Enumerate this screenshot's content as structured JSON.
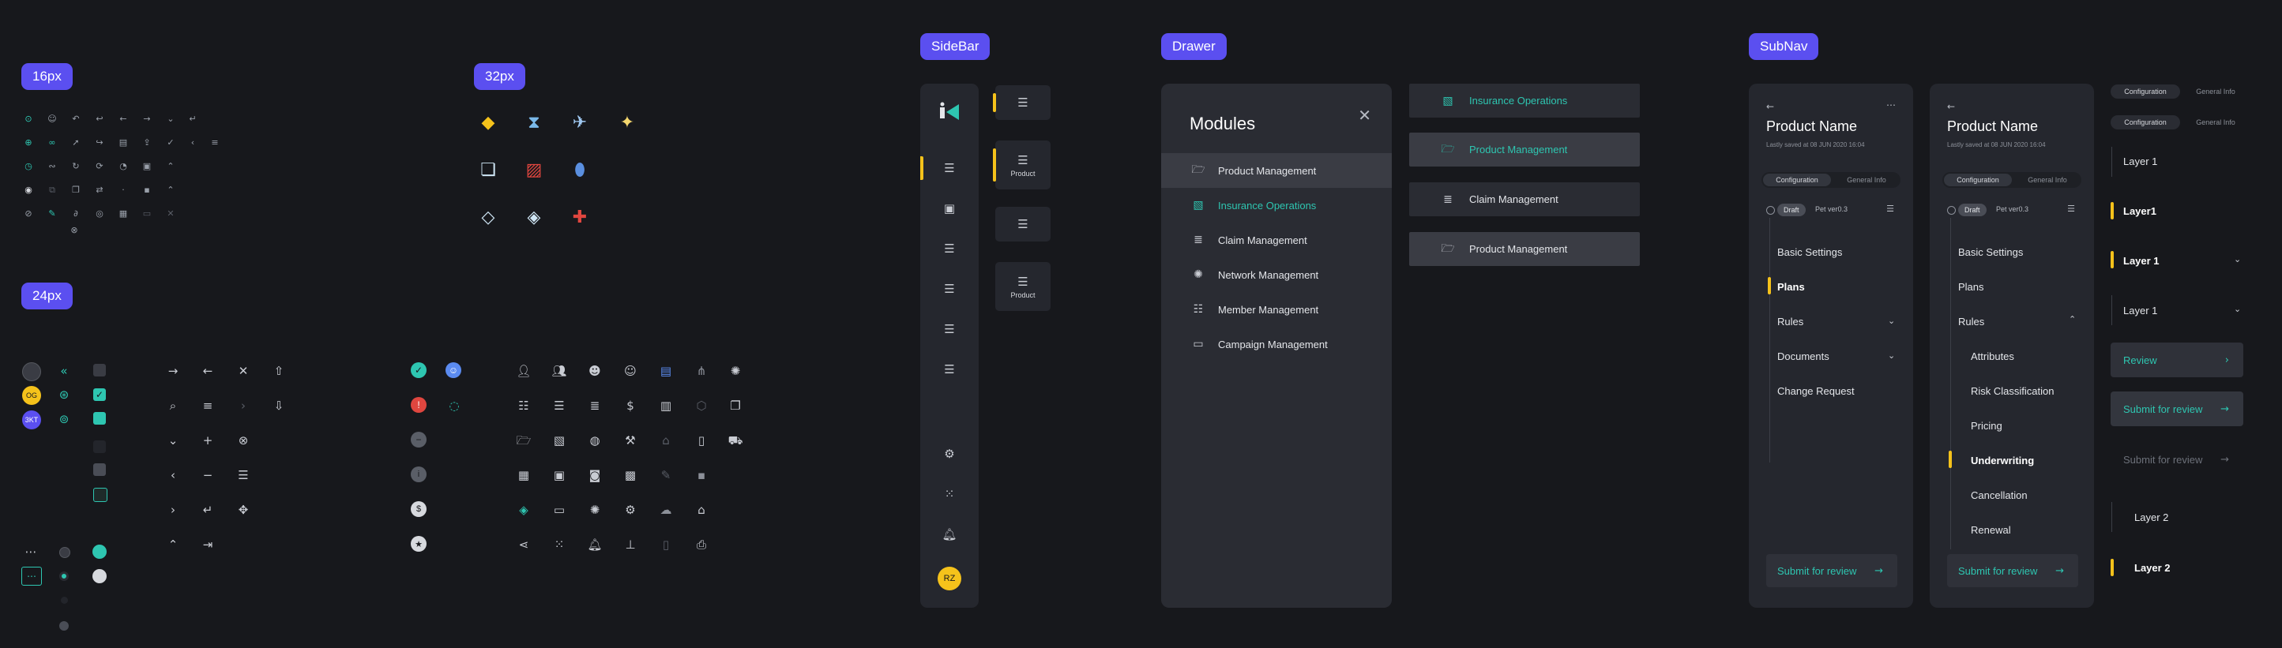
{
  "colors": {
    "background": "#17181c",
    "panel": "#25272e",
    "accent_purple": "#5b4ff0",
    "accent_teal": "#2ec6b1",
    "accent_yellow": "#f5c21b",
    "danger": "#e0463f"
  },
  "tags": {
    "s16": "16px",
    "s32": "32px",
    "s24": "24px",
    "sidebar": "SideBar",
    "drawer": "Drawer",
    "subnav": "SubNav"
  },
  "icons16": [
    "info-icon",
    "person-add-icon",
    "reply-icon",
    "arrow-left-icon",
    "arrow-right-icon",
    "chevron-down-icon",
    "enter-icon",
    "add-circle-icon",
    "link-icon",
    "send-icon",
    "file-icon",
    "upload-icon",
    "check-icon",
    "chevron-left-icon",
    "menu-icon",
    "history-icon",
    "reload-icon",
    "refresh-icon",
    "pending-icon",
    "lock-icon",
    "chevron-up-icon",
    "check-circle-icon",
    "external-link-icon",
    "copy-icon",
    "swap-icon",
    "dot-icon",
    "delete-icon",
    "chevron-up-small-icon",
    "block-icon",
    "edit-icon",
    "attach-icon",
    "eye-icon",
    "calendar-icon",
    "keyboard-icon",
    "close-icon",
    "eye-off-icon"
  ],
  "icons32": [
    "tag-icon",
    "hourglass-icon",
    "plane-icon",
    "bulb-icon",
    "documents-icon",
    "document-alert-icon",
    "pill-icon",
    "box-icon",
    "package-icon",
    "medkit-icon"
  ],
  "avatar_initials": {
    "small": "RZ",
    "large": "OG",
    "numeric": "3KT"
  },
  "sidebar": {
    "avatar": "RZ",
    "card_label": "Product"
  },
  "drawer": {
    "title": "Modules",
    "items": [
      {
        "label": "Product Management",
        "icon": "folder-icon"
      },
      {
        "label": "Insurance Operations",
        "icon": "library-icon"
      },
      {
        "label": "Claim Management",
        "icon": "claim-icon"
      },
      {
        "label": "Network Management",
        "icon": "network-icon"
      },
      {
        "label": "Member Management",
        "icon": "members-icon"
      },
      {
        "label": "Campaign Management",
        "icon": "ticket-icon"
      }
    ],
    "tiles": [
      {
        "label": "Insurance Operations",
        "icon": "library-icon"
      },
      {
        "label": "Product Management",
        "icon": "folder-icon"
      },
      {
        "label": "Claim Management",
        "icon": "claim-icon"
      },
      {
        "label": "Product Management",
        "icon": "folder-icon"
      }
    ]
  },
  "subnav": {
    "product_name": "Product Name",
    "saved": "Lastly saved at 08 JUN 2020 16:04",
    "tab_config": "Configuration",
    "tab_general": "General Info",
    "draft": "Draft",
    "version": "Pet ver0.3",
    "panel1_items": [
      "Basic Settings",
      "Plans",
      "Rules",
      "Documents",
      "Change Request"
    ],
    "panel2_items": [
      "Basic Settings",
      "Plans",
      "Rules"
    ],
    "panel2_subitems": [
      "Attributes",
      "Risk Classification",
      "Pricing",
      "Underwriting",
      "Cancellation",
      "Renewal"
    ],
    "submit": "Submit for review"
  },
  "variants": {
    "tab_config": "Configuration",
    "tab_general": "General Info",
    "layers": [
      "Layer 1",
      "Layer1",
      "Layer 1",
      "Layer 1"
    ],
    "review": "Review",
    "submit": "Submit for review",
    "layer2": "Layer 2"
  }
}
